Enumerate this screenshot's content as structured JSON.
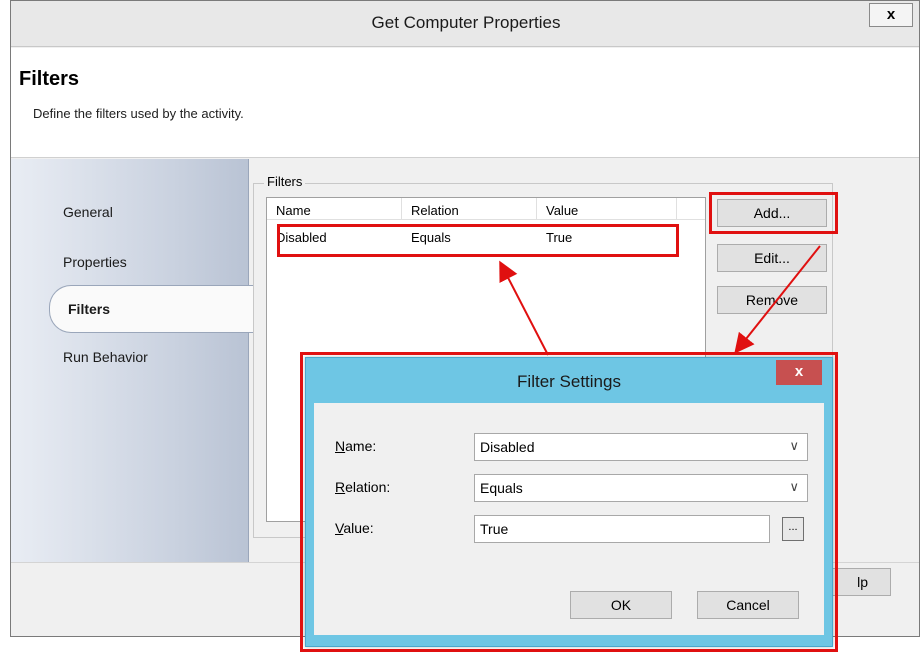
{
  "window": {
    "title": "Get Computer Properties",
    "close_glyph": "x"
  },
  "header": {
    "title": "Filters",
    "subtitle": "Define the filters used by the activity."
  },
  "sidebar": {
    "items": [
      {
        "label": "General",
        "active": false
      },
      {
        "label": "Properties",
        "active": false
      },
      {
        "label": "Filters",
        "active": true
      },
      {
        "label": "Run Behavior",
        "active": false
      }
    ]
  },
  "filters": {
    "group_label": "Filters",
    "columns": [
      "Name",
      "Relation",
      "Value"
    ],
    "rows": [
      {
        "name": "Disabled",
        "relation": "Equals",
        "value": "True"
      }
    ],
    "buttons": {
      "add": "Add...",
      "edit": "Edit...",
      "remove": "Remove"
    }
  },
  "footer": {
    "help_partial": "lp"
  },
  "dialog": {
    "title": "Filter Settings",
    "close_glyph": "x",
    "fields": {
      "name_label_key": "N",
      "name_label_rest": "ame:",
      "name_value": "Disabled",
      "relation_label_key": "R",
      "relation_label_rest": "elation:",
      "relation_value": "Equals",
      "value_label_key": "V",
      "value_label_rest": "alue:",
      "value_value": "True",
      "ellipsis": "..."
    },
    "ok_label": "OK",
    "cancel_label": "Cancel"
  },
  "colors": {
    "highlight": "#e01010",
    "dialog_frame": "#6ec6e4",
    "dialog_close": "#c75050"
  }
}
